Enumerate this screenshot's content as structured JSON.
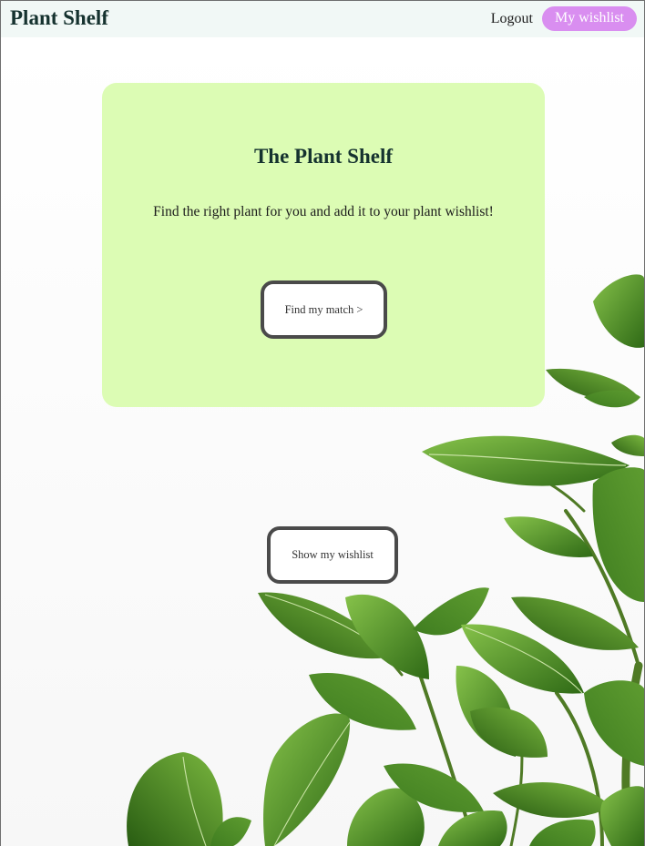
{
  "navbar": {
    "brand": "Plant Shelf",
    "logout_label": "Logout",
    "wishlist_label": "My wishlist"
  },
  "hero": {
    "title": "The Plant Shelf",
    "subtitle": "Find the right plant for you and add it to your plant wishlist!",
    "match_button_label": "Find my match >"
  },
  "main": {
    "show_wishlist_label": "Show my wishlist"
  },
  "background": {
    "image": "plant-leaves-photo"
  },
  "colors": {
    "navbar_bg": "#f1f8f6",
    "brand_text": "#15322f",
    "wishlist_pill": "#d98ef0",
    "hero_card_bg": "#dcfcb4",
    "button_border": "#4a4a4a",
    "leaf_dark": "#3d7a1f",
    "leaf_light": "#6fae3c"
  }
}
